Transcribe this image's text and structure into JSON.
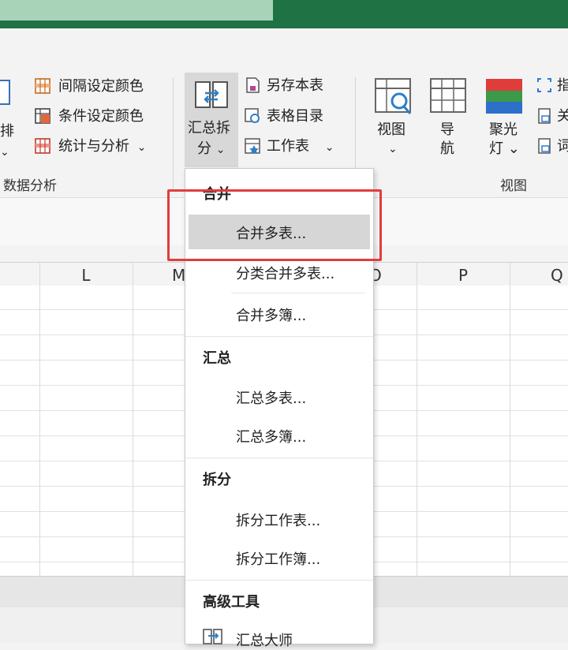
{
  "ribbon": {
    "left_partial_label": "排",
    "group_data_analysis": {
      "items": [
        {
          "label": "间隔设定颜色",
          "icon": "grid-color-icon"
        },
        {
          "label": "条件设定颜色",
          "icon": "condition-color-icon"
        },
        {
          "label": "统计与分析",
          "icon": "statistics-icon",
          "arrow": "⌄"
        }
      ],
      "group_label": "数据分析"
    },
    "summary_split_button": {
      "line1": "汇总拆",
      "line2": "分",
      "arrow": "⌄"
    },
    "group_file": {
      "items": [
        {
          "label": "另存本表",
          "icon": "save-copy-icon"
        },
        {
          "label": "表格目录",
          "icon": "table-directory-icon"
        },
        {
          "label": "工作表",
          "icon": "worksheet-icon",
          "arrow": "⌄"
        }
      ]
    },
    "group_view": {
      "buttons": [
        {
          "line1": "视图",
          "line2": "⌄",
          "icon": "view-icon"
        },
        {
          "line1": "导",
          "line2": "航",
          "icon": "navigation-icon"
        },
        {
          "line1": "聚光",
          "line2": "灯 ⌄",
          "icon": "spotlight-icon"
        }
      ],
      "group_label": "视图"
    },
    "right_partial": [
      "指",
      "关",
      "词"
    ]
  },
  "columns": [
    "L",
    "M",
    "O",
    "P",
    "Q"
  ],
  "dropdown": {
    "sections": [
      {
        "header": "合并",
        "items": [
          "合并多表...",
          "分类合并多表...",
          "合并多簿..."
        ]
      },
      {
        "header": "汇总",
        "items": [
          "汇总多表...",
          "汇总多簿..."
        ]
      },
      {
        "header": "拆分",
        "items": [
          "拆分工作表...",
          "拆分工作簿..."
        ]
      },
      {
        "header": "高级工具",
        "items": [
          "汇总大师"
        ]
      }
    ],
    "highlighted_item": "合并多表..."
  },
  "colors": {
    "title_bar": "#1f7244",
    "highlight_box": "#e23c3c"
  }
}
